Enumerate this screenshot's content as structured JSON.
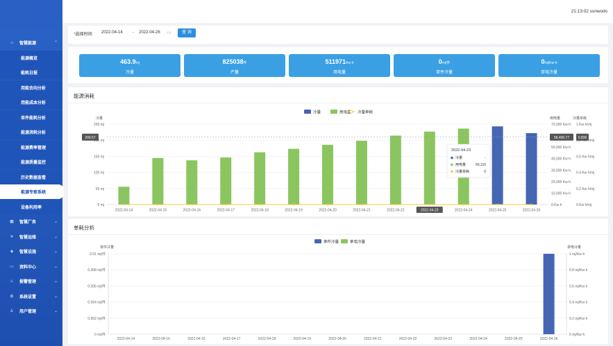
{
  "header": {
    "clock_user": "21:13:02  ssnwods"
  },
  "sidebar": {
    "items": [
      {
        "label": "智慧能源",
        "icon": "home-icon",
        "top": true,
        "expanded": true
      },
      {
        "label": "能源概览",
        "sub": true
      },
      {
        "label": "能耗日报",
        "sub": true
      },
      {
        "label": "用能去向分析",
        "sub": true
      },
      {
        "label": "用能成本分析",
        "sub": true
      },
      {
        "label": "单件能耗分析",
        "sub": true
      },
      {
        "label": "能源消耗分析",
        "sub": true
      },
      {
        "label": "能源费率管理",
        "sub": true
      },
      {
        "label": "能源质量监控",
        "sub": true
      },
      {
        "label": "历史数据查看",
        "sub": true
      },
      {
        "label": "能源专家系统",
        "sub": true,
        "active": true
      },
      {
        "label": "设备利用率",
        "sub": true
      },
      {
        "label": "智慧厂务",
        "icon": "factory-icon",
        "top": true
      },
      {
        "label": "智慧运维",
        "icon": "wrench-icon",
        "top": true
      },
      {
        "label": "智慧设施",
        "icon": "building-icon",
        "top": true
      },
      {
        "label": "资料中心",
        "icon": "folder-icon",
        "top": true
      },
      {
        "label": "报警管理",
        "icon": "bell-icon",
        "top": true
      },
      {
        "label": "系统设置",
        "icon": "gear-icon",
        "top": true
      },
      {
        "label": "用户管理",
        "icon": "user-icon",
        "top": true
      }
    ]
  },
  "filter": {
    "label": "选择时间:",
    "start_date": "2022-04-14",
    "separator": "–",
    "end_date": "2022-04-26",
    "query_button": "查 询"
  },
  "stats": [
    {
      "value": "463.9",
      "unit": "mj",
      "name": "冷量"
    },
    {
      "value": "825038",
      "unit": "件",
      "name": "产量"
    },
    {
      "value": "511971",
      "unit": "Kw·h",
      "name": "用电量"
    },
    {
      "value": "0",
      "unit": "mj/件",
      "name": "单件冷量"
    },
    {
      "value": "0",
      "unit": "mj/Kw·h",
      "name": "单电冷量"
    }
  ],
  "energy_panel": {
    "title": "能源消耗"
  },
  "unit_panel": {
    "title": "单耗分析"
  },
  "chart_data": [
    {
      "type": "bar",
      "title": "",
      "categories": [
        "2022-04-14",
        "2022-04-15",
        "2022-04-16",
        "2022-04-17",
        "2022-04-18",
        "2022-04-19",
        "2022-04-20",
        "2022-04-21",
        "2022-04-22",
        "2022-04-23",
        "2022-04-24",
        "2022-04-25",
        "2022-04-26"
      ],
      "legend": [
        "冷量",
        "用电量",
        "冷量单耗"
      ],
      "legend_position": "top-center",
      "series": [
        {
          "name": "冷量",
          "axis": "left",
          "color": "#4666b4",
          "values": [
            0,
            0,
            0,
            0,
            0,
            0,
            0,
            0,
            0,
            0,
            0,
            243,
            222
          ]
        },
        {
          "name": "用电量",
          "axis": "right1",
          "color": "#8bc560",
          "values": [
            15500,
            40500,
            38500,
            41000,
            45500,
            48500,
            52000,
            55500,
            60000,
            63500,
            66116,
            0,
            0
          ]
        },
        {
          "name": "冷量单耗",
          "axis": "right2",
          "color": "#f5c842",
          "type": "line",
          "values": [
            0,
            0,
            0,
            0,
            0,
            0,
            0,
            0,
            0,
            0,
            0,
            0,
            0
          ]
        }
      ],
      "y_left": {
        "label": "冷量",
        "min": 0,
        "max": 250,
        "ticks": [
          "0 mj",
          "50 mj",
          "100 mj",
          "150 mj",
          "200 mj",
          "250 mj"
        ]
      },
      "y_right1": {
        "label": "用电量",
        "min": 0,
        "max": 70000,
        "ticks": [
          "0 Kw·h",
          "10,000 Kw·h",
          "20,000 Kw·h",
          "30,000 Kw·h",
          "40,000 Kw·h",
          "50,000 Kw·h",
          "60,000 Kw·h",
          "70,000 Kw·h"
        ]
      },
      "y_right2": {
        "label": "冷量单耗",
        "min": 0,
        "max": 1,
        "ticks": [
          "0 Kw·h/mj",
          "0.2 Kw·h/mj",
          "0.4 Kw·h/mj",
          "0.6 Kw·h/mj",
          "0.8 Kw·h/mj",
          "1 Kw·h/mj"
        ]
      },
      "crosshair": {
        "left_value": "209.57",
        "right1_value": "58,400.77",
        "right2_value": "0.836",
        "x_label": "2022-04-23"
      },
      "tooltip": {
        "title": "2022-04-23",
        "rows": [
          {
            "name": "冷量",
            "value": "-",
            "color": "#4666b4"
          },
          {
            "name": "用电量",
            "value": "66,116",
            "color": "#8bc560"
          },
          {
            "name": "冷量单耗",
            "value": "0",
            "color": "#f5c842"
          }
        ]
      },
      "grid": true
    },
    {
      "type": "bar",
      "title": "",
      "categories": [
        "2022-04-14",
        "2022-04-15",
        "2022-04-16",
        "2022-04-17",
        "2022-04-18",
        "2022-04-19",
        "2022-04-20",
        "2022-04-21",
        "2022-04-22",
        "2022-04-23",
        "2022-04-24",
        "2022-04-25",
        "2022-04-26"
      ],
      "legend": [
        "单件冷量",
        "单电冷量"
      ],
      "legend_position": "top-center",
      "series": [
        {
          "name": "单件冷量",
          "axis": "left",
          "color": "#4666b4",
          "values": [
            0,
            0,
            0,
            0,
            0,
            0,
            0,
            0,
            0,
            0,
            0,
            0,
            0.01
          ]
        },
        {
          "name": "单电冷量",
          "axis": "right",
          "color": "#8bc560",
          "values": [
            0,
            0,
            0,
            0,
            0,
            0,
            0,
            0,
            0,
            0,
            0,
            0,
            0
          ]
        }
      ],
      "y_left": {
        "label": "单件冷量",
        "min": 0,
        "max": 0.01,
        "ticks": [
          "0 mj/件",
          "0.002 mj/件",
          "0.004 mj/件",
          "0.006 mj/件",
          "0.008 mj/件",
          "0.01 mj/件"
        ]
      },
      "y_right": {
        "label": "单电冷量",
        "min": 0,
        "max": 1,
        "ticks": [
          "0 mj/Kw·h",
          "0.2 mj/Kw·h",
          "0.4 mj/Kw·h",
          "0.6 mj/Kw·h",
          "0.8 mj/Kw·h",
          "1 mj/Kw·h"
        ]
      },
      "grid": true
    }
  ]
}
